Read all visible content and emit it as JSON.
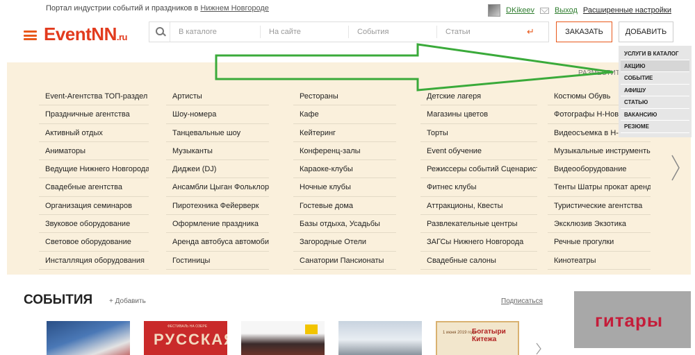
{
  "topbar": {
    "tagline_prefix": "Портал индустрии событий и праздников в ",
    "tagline_city": "Нижнем Новгороде",
    "username": "DKikeev",
    "logout": "Выход",
    "advanced": "Расширенные настройки"
  },
  "header": {
    "logo_main": "EventNN",
    "logo_suffix": ".ru",
    "search_segments": [
      "В каталоге",
      "На сайте",
      "События",
      "Статьи"
    ],
    "order_button": "ЗАКАЗАТЬ",
    "add_button": "ДОБАВИТЬ"
  },
  "dropdown": {
    "items": [
      "УСЛУГИ В КАТАЛОГ",
      "АКЦИЮ",
      "СОБЫТИЕ",
      "АФИШУ",
      "СТАТЬЮ",
      "ВАКАНСИЮ",
      "РЕЗЮМЕ"
    ],
    "active_index": 1
  },
  "catalog": {
    "place_label": "РАЗМЕСТИТЬ",
    "columns": [
      [
        "Event-Агентства ТОП-раздел",
        "Праздничные агентства",
        "Активный отдых",
        "Аниматоры",
        "Ведущие Нижнего Новгорода",
        "Свадебные агентства",
        "Организация семинаров",
        "Звуковое оборудование",
        "Световое оборудование",
        "Инсталляция оборудования"
      ],
      [
        "Артисты",
        "Шоу-номера",
        "Танцевальные шоу",
        "Музыканты",
        "Диджеи (DJ)",
        "Ансамбли Цыган Фольклор",
        "Пиротехника Фейерверк",
        "Оформление праздника",
        "Аренда автобуса автомобиля",
        "Гостиницы"
      ],
      [
        "Рестораны",
        "Кафе",
        "Кейтеринг",
        "Конференц-залы",
        "Караоке-клубы",
        "Ночные клубы",
        "Гостевые дома",
        "Базы отдыха, Усадьбы",
        "Загородные Отели",
        "Санатории Пансионаты"
      ],
      [
        "Детские лагеря",
        "Магазины цветов",
        "Торты",
        "Event обучение",
        "Режиссеры событий Сценаристы",
        "Фитнес клубы",
        "Аттракционы, Квесты",
        "Развлекательные центры",
        "ЗАГСы Нижнего Новгорода",
        "Свадебные салоны"
      ],
      [
        "Костюмы Обувь",
        "Фотографы Н-Новгорода",
        "Видеосъемка в Н-Новгороде",
        "Музыкальные инструменты",
        "Видеооборудование",
        "Тенты Шатры прокат аренда",
        "Туристические агентства",
        "Эксклюзив Экзотика",
        "Речные прогулки",
        "Кинотеатры"
      ]
    ]
  },
  "events": {
    "title": "СОБЫТИЯ",
    "add_link": "+ Добавить",
    "subscribe": "Подписаться",
    "promo_text": "гитары",
    "thumb2_title": "РУССКАЯ",
    "thumb2_sub": "ФЕСТИВАЛЬ НА ОЗЕРЕ",
    "thumb5_title": "Богатыри Китежа",
    "thumb5_sub": "1 июня 2019 года"
  },
  "colors": {
    "accent": "#e8581a",
    "logo": "#e23b1e",
    "catalog_bg": "#faf0dc",
    "arrow": "#3aaa3a"
  }
}
